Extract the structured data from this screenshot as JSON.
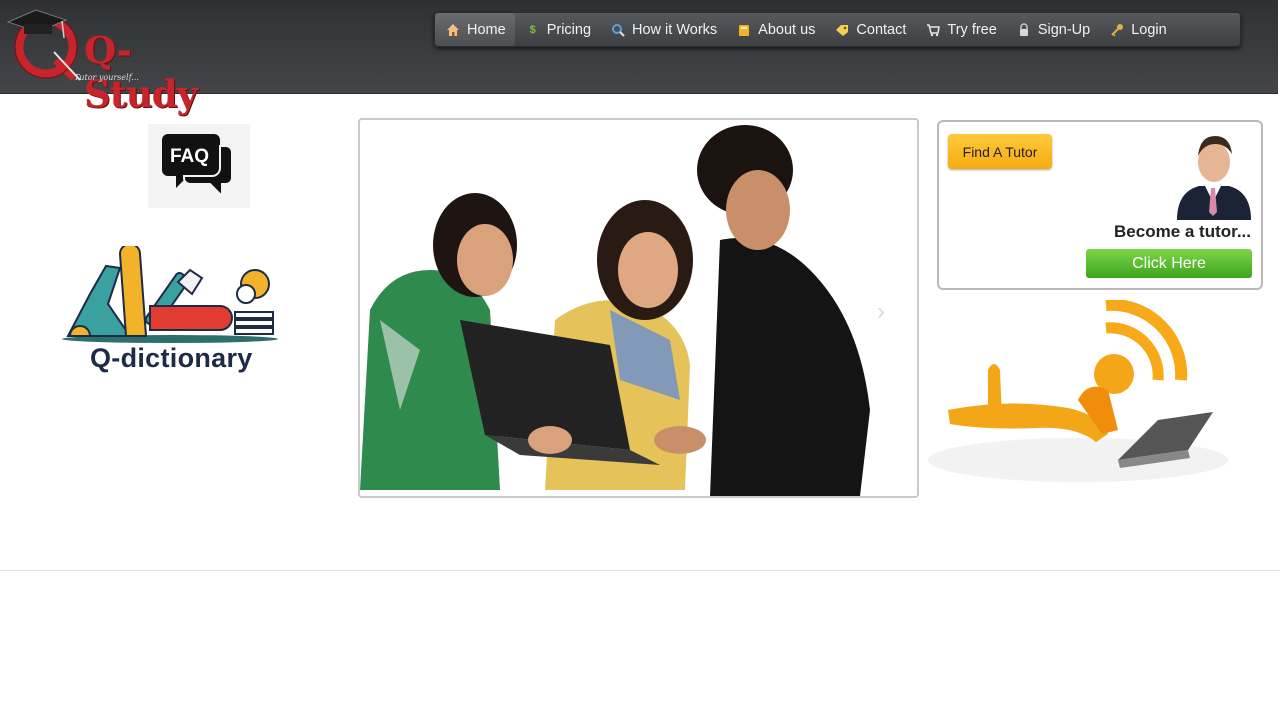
{
  "logo": {
    "text": "Q-Study",
    "tagline": "Tutor yourself..."
  },
  "nav": {
    "items": [
      {
        "label": "Home",
        "icon": "home-icon",
        "active": true
      },
      {
        "label": "Pricing",
        "icon": "dollar-icon"
      },
      {
        "label": "How it Works",
        "icon": "magnifier-icon"
      },
      {
        "label": "About us",
        "icon": "book-icon"
      },
      {
        "label": "Contact",
        "icon": "tag-icon"
      },
      {
        "label": "Try free",
        "icon": "cart-icon"
      },
      {
        "label": "Sign-Up",
        "icon": "lock-icon"
      },
      {
        "label": "Login",
        "icon": "key-icon"
      }
    ]
  },
  "sidebar": {
    "faq_label": "FAQ",
    "dictionary_label": "Q-dictionary"
  },
  "tutor": {
    "find_label": "Find A Tutor",
    "become_label": "Become a tutor...",
    "click_label": "Click Here"
  },
  "slider": {
    "next_arrow": "›"
  },
  "colors": {
    "header": "#3b3d41",
    "accent_orange": "#f5ab12",
    "accent_green": "#3aa51c",
    "brand_red": "#c8242b"
  }
}
